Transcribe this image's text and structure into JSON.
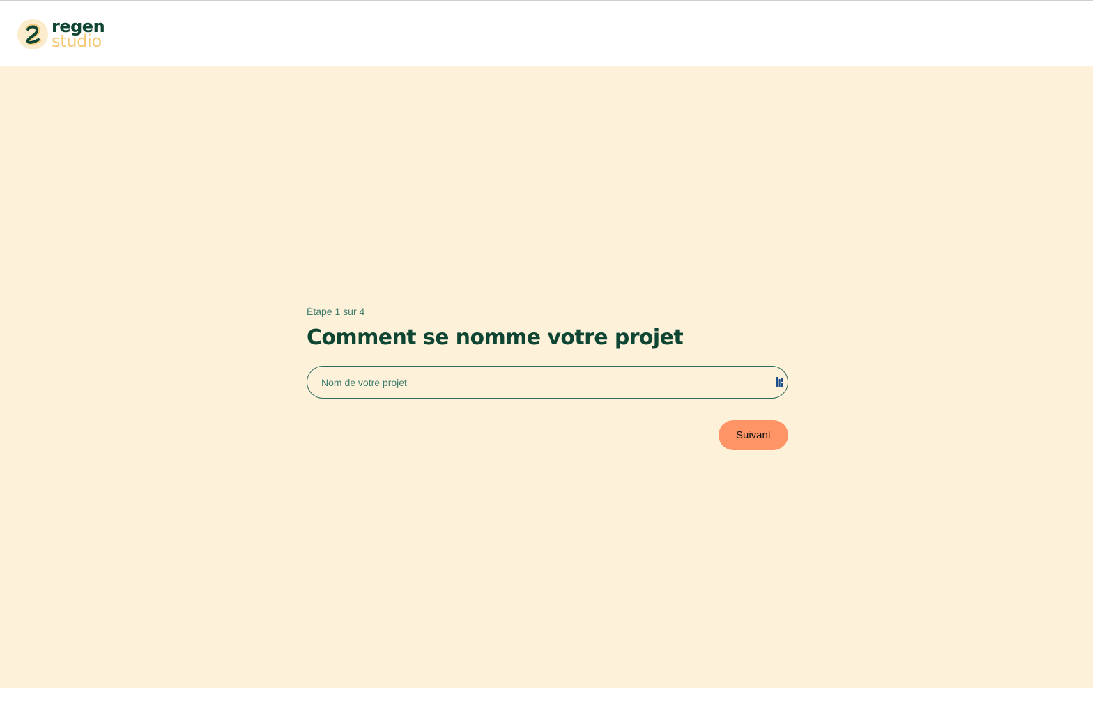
{
  "brand": {
    "name_line1": "regen",
    "name_line2": "studio",
    "logo_icon": "regen-swirl-logo-icon"
  },
  "onboarding": {
    "step_label": "Étape 1 sur 4",
    "question": "Comment se nomme votre projet",
    "project_name": {
      "value": "",
      "placeholder": "Nom de votre projet",
      "trailing_icon": "password-manager-autofill-icon"
    },
    "next_label": "Suivant"
  },
  "colors": {
    "background": "#fdf1da",
    "header_background": "#ffffff",
    "primary_green": "#0f4633",
    "muted_green": "#3e7d6c",
    "logo_yellow": "#f6c873",
    "button_orange": "#ff9466"
  }
}
